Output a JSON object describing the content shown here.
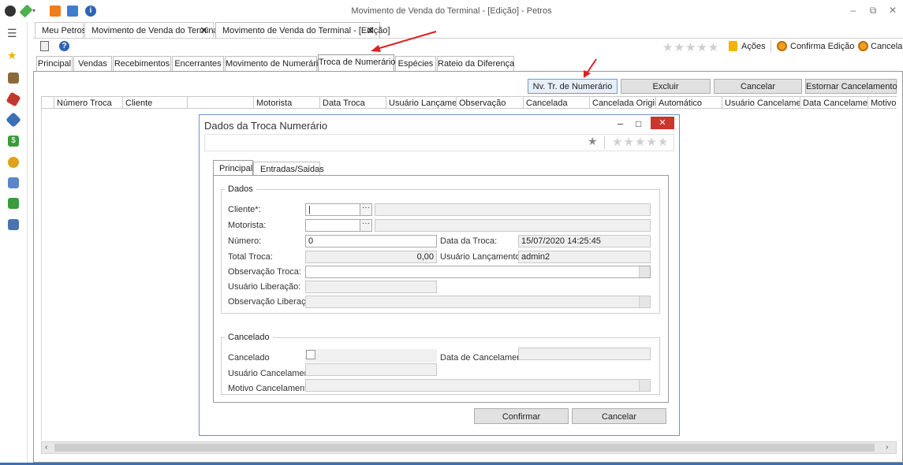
{
  "window": {
    "title": "Movimento de Venda do Terminal - [Edição] - Petros",
    "controls": [
      "–",
      "⧉",
      "✕"
    ]
  },
  "doc_tabs": [
    {
      "label": "Meu Petros"
    },
    {
      "label": "Movimento de Venda do Terminal",
      "close": "✕"
    },
    {
      "label": "Movimento de Venda do Terminal - [Edição]",
      "close": "✕"
    }
  ],
  "ribbon": {
    "acoes": "Ações",
    "confirma": "Confirma Edição",
    "cancela": "Cancela",
    "stars": "★★★★★"
  },
  "inner_tabs": [
    "Principal",
    "Vendas",
    "Recebimentos",
    "Encerrantes",
    "Movimento de Numerário",
    "Troca de Numerário",
    "Espécies",
    "Rateio da Diferença"
  ],
  "grid_buttons": [
    "Nv. Tr. de Numerário",
    "Excluir",
    "Cancelar",
    "Estornar Cancelamento"
  ],
  "grid_columns": [
    "Número Troca",
    "Cliente",
    "",
    "Motorista",
    "Data Troca",
    "Usuário Lançamento",
    "Observação",
    "Cancelada",
    "Cancelada Original",
    "Automático",
    "Usuário Cancelamento",
    "Data Cancelamento",
    "Motivo"
  ],
  "dialog": {
    "title": "Dados da Troca Numerário",
    "controls": [
      "–",
      "□",
      "✕"
    ],
    "star": "★",
    "stars": "★★★★★",
    "tabs": [
      "Principal",
      "Entradas/Saidas"
    ],
    "group_dados": "Dados",
    "group_cancelado": "Cancelado",
    "fields": {
      "cliente": {
        "label": "Cliente*:",
        "value": "|"
      },
      "motorista": {
        "label": "Motorista:",
        "value": ""
      },
      "numero": {
        "label": "Número:",
        "value": "0"
      },
      "data_troca": {
        "label": "Data da Troca:",
        "value": "15/07/2020 14:25:45"
      },
      "total_troca": {
        "label": "Total Troca:",
        "value": "0,00"
      },
      "usuario_lancamento": {
        "label": "Usuário Lançamento:",
        "value": "admin2"
      },
      "observacao_troca": {
        "label": "Observação Troca:",
        "value": ""
      },
      "usuario_liberacao": {
        "label": "Usuário Liberação:",
        "value": ""
      },
      "observacao_liberacao": {
        "label": "Observação Liberação:",
        "value": ""
      },
      "cancelado": {
        "label": "Cancelado"
      },
      "data_cancelamento": {
        "label": "Data de Cancelamento:",
        "value": ""
      },
      "usuario_cancelamento": {
        "label": "Usuário Cancelamento:",
        "value": ""
      },
      "motivo_cancelamento": {
        "label": "Motivo Cancelamento:",
        "value": ""
      }
    },
    "buttons": {
      "confirmar": "Confirmar",
      "cancelar": "Cancelar"
    }
  },
  "sidebar": {
    "menu": "☰",
    "items": [
      "star-icon",
      "people-icon",
      "tools-icon",
      "wrench-icon",
      "money-icon",
      "lion-icon",
      "table-icon",
      "home-icon",
      "search-report-icon"
    ]
  },
  "colors": {
    "accent": "#3b6fb6",
    "annotation_arrow": "#e02020",
    "close_red": "#c8362e"
  }
}
